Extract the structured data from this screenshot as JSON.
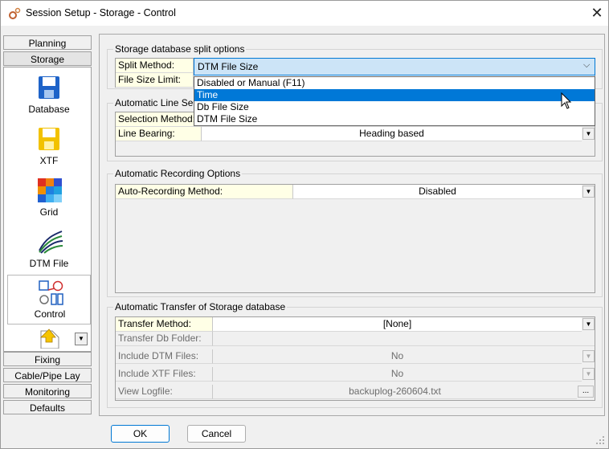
{
  "window": {
    "title": "Session Setup - Storage -  Control",
    "close_glyph": "✕",
    "icon": "gears-icon"
  },
  "nav": {
    "top_tabs": [
      "Planning",
      "Storage"
    ],
    "icons": [
      {
        "label": "Database",
        "icon": "floppy-disk-blue-icon"
      },
      {
        "label": "XTF",
        "icon": "floppy-disk-yellow-icon"
      },
      {
        "label": "Grid",
        "icon": "grid-colormap-icon"
      },
      {
        "label": "DTM File",
        "icon": "dtm-surface-icon"
      },
      {
        "label": "Control",
        "icon": "control-shapes-icon"
      },
      {
        "label": "",
        "icon": "export-page-icon"
      }
    ],
    "scroll_glyph": "▼",
    "bottom_tabs": [
      "Fixing",
      "Cable/Pipe Lay",
      "Monitoring",
      "Defaults"
    ]
  },
  "split_group": {
    "title": "Storage database split options",
    "rows": [
      {
        "label": "Split Method:",
        "value": "DTM File Size"
      },
      {
        "label": "File Size Limit:",
        "value": ""
      }
    ],
    "options": [
      "Disabled or Manual (F11)",
      "Time",
      "Db File Size",
      "DTM File Size"
    ],
    "highlighted": "Time"
  },
  "line_group": {
    "title": "Automatic Line Selec",
    "rows": [
      {
        "label": "Selection Method:",
        "value": ""
      },
      {
        "label": "Line Bearing:",
        "value": "Heading based"
      }
    ]
  },
  "recording_group": {
    "title": "Automatic Recording Options",
    "rows": [
      {
        "label": "Auto-Recording Method:",
        "value": "Disabled"
      }
    ]
  },
  "transfer_group": {
    "title": "Automatic Transfer of Storage database",
    "rows": [
      {
        "label": "Transfer Method:",
        "value": "[None]"
      },
      {
        "label": "Transfer Db Folder:",
        "value": ""
      },
      {
        "label": "Include DTM Files:",
        "value": "No"
      },
      {
        "label": "Include XTF Files:",
        "value": "No"
      },
      {
        "label": "View Logfile:",
        "value": "backuplog-260604.txt"
      }
    ],
    "browse_glyph": "..."
  },
  "dd_glyph": "▼",
  "chevron_glyph": "⌵",
  "buttons": {
    "ok": "OK",
    "cancel": "Cancel"
  }
}
